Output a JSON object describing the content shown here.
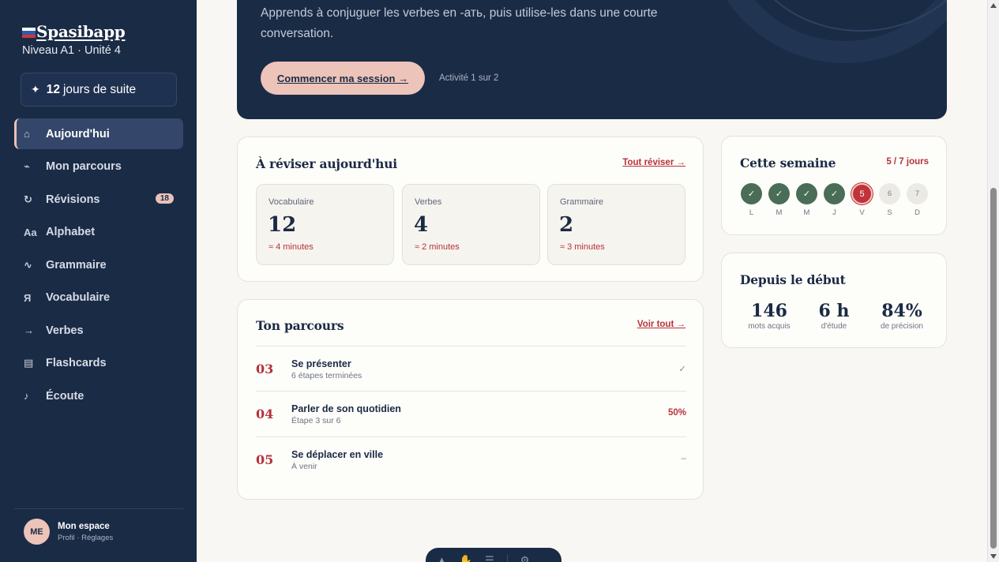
{
  "sidebar": {
    "brand": "Spasibapp",
    "level": "Niveau A1 · Unité 4",
    "streak": {
      "count": "12",
      "label": "jours de suite"
    },
    "items": [
      {
        "label": "Aujourd'hui",
        "icon": "⌂"
      },
      {
        "label": "Mon parcours",
        "icon": "⌁"
      },
      {
        "label": "Révisions",
        "icon": "↻",
        "badge": "18"
      },
      {
        "label": "Alphabet",
        "icon": "Aa"
      },
      {
        "label": "Grammaire",
        "icon": "∿"
      },
      {
        "label": "Vocabulaire",
        "icon": "Я"
      },
      {
        "label": "Verbes",
        "icon": "→"
      },
      {
        "label": "Flashcards",
        "icon": "▤"
      },
      {
        "label": "Écoute",
        "icon": "♪"
      }
    ],
    "account": {
      "initials": "ME",
      "name": "Mon espace",
      "sub": "Profil · Réglages"
    }
  },
  "hero": {
    "description": "Apprends à conjuguer les verbes en -ать, puis utilise-les dans une courte conversation.",
    "button": "Commencer ma session →",
    "activity": "Activité 1 sur 2"
  },
  "review": {
    "title": "À réviser aujourd'hui",
    "link": "Tout réviser →",
    "tiles": [
      {
        "label": "Vocabulaire",
        "value": "12",
        "time": "≈ 4 minutes"
      },
      {
        "label": "Verbes",
        "value": "4",
        "time": "≈ 2 minutes"
      },
      {
        "label": "Grammaire",
        "value": "2",
        "time": "≈ 3 minutes"
      }
    ]
  },
  "path": {
    "title": "Ton parcours",
    "link": "Voir tout →",
    "rows": [
      {
        "num": "03",
        "title": "Se présenter",
        "sub": "6 étapes terminées",
        "status": "✓"
      },
      {
        "num": "04",
        "title": "Parler de son quotidien",
        "sub": "Étape 3 sur 6",
        "status": "50%"
      },
      {
        "num": "05",
        "title": "Se déplacer en ville",
        "sub": "À venir",
        "status": "–"
      }
    ]
  },
  "week": {
    "title": "Cette semaine",
    "count": "5 / 7 jours",
    "days": [
      {
        "label": "L",
        "mark": "✓",
        "state": "done"
      },
      {
        "label": "M",
        "mark": "✓",
        "state": "done"
      },
      {
        "label": "M",
        "mark": "✓",
        "state": "done"
      },
      {
        "label": "J",
        "mark": "✓",
        "state": "done"
      },
      {
        "label": "V",
        "mark": "5",
        "state": "today"
      },
      {
        "label": "S",
        "mark": "6",
        "state": "future"
      },
      {
        "label": "D",
        "mark": "7",
        "state": "future"
      }
    ]
  },
  "since": {
    "title": "Depuis le début",
    "stats": [
      {
        "value": "146",
        "label": "mots acquis"
      },
      {
        "value": "6 h",
        "label": "d'étude"
      },
      {
        "value": "84%",
        "label": "de précision"
      }
    ]
  },
  "colors": {
    "navy": "#1a2b46",
    "accent": "#b6323a",
    "peach": "#ecc4b9",
    "done": "#4a6d57"
  }
}
